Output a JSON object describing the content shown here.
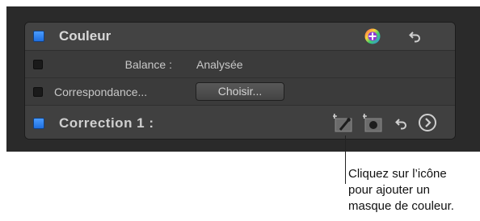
{
  "panel": {
    "header": {
      "title": "Couleur",
      "enabled": true
    },
    "rows": [
      {
        "label": "Balance :",
        "value": "Analysée"
      },
      {
        "label": "Correspondance...",
        "button_label": "Choisir..."
      }
    ],
    "correction": {
      "title": "Correction 1 :",
      "enabled": true
    }
  },
  "callout": {
    "lines": [
      "Cliquez sur l’icône",
      "pour ajouter un",
      "masque de couleur."
    ]
  },
  "icons": {
    "header_add": "color-add-icon",
    "header_reset": "reset-arrow-icon",
    "color_mask": "color-mask-icon",
    "shape_mask": "shape-mask-icon",
    "correction_reset": "reset-arrow-icon",
    "navigate": "chevron-right-circle-icon"
  }
}
